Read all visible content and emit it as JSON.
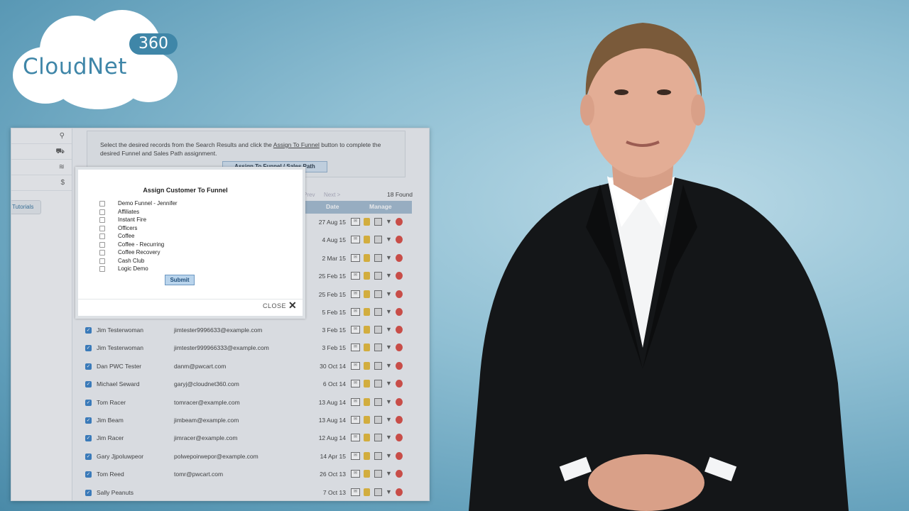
{
  "logo": {
    "brand": "CloudNet",
    "badge": "360"
  },
  "sidebar": {
    "tutorials": "Tutorials"
  },
  "instructions": {
    "text_before": "Select the desired records from the Search Results and click the ",
    "link": "Assign To Funnel",
    "text_after": " button to complete the desired Funnel and Sales Path assignment.",
    "button": "Assign To Funnel / Sales Path"
  },
  "pager": {
    "prev": "Prev",
    "next": "Next >",
    "found": "18 Found"
  },
  "table": {
    "headers": {
      "date": "Date",
      "manage": "Manage"
    },
    "hidden_dates": [
      "27 Aug 15",
      "4 Aug 15",
      "2 Mar 15",
      "25 Feb 15",
      "25 Feb 15",
      "5 Feb 15"
    ],
    "rows": [
      {
        "name": "Jim Testerwoman",
        "email": "jimtester9996633@example.com",
        "date": "3 Feb 15"
      },
      {
        "name": "Jim Testerwoman",
        "email": "jimtester999966333@example.com",
        "date": "3 Feb 15"
      },
      {
        "name": "Dan PWC Tester",
        "email": "danm@pwcart.com",
        "date": "30 Oct 14"
      },
      {
        "name": "Michael Seward",
        "email": "garyj@cloudnet360.com",
        "date": "6 Oct 14"
      },
      {
        "name": "Tom Racer",
        "email": "tomracer@example.com",
        "date": "13 Aug 14"
      },
      {
        "name": "Jim Beam",
        "email": "jimbeam@example.com",
        "date": "13 Aug 14"
      },
      {
        "name": "Jim Racer",
        "email": "jimracer@example.com",
        "date": "12 Aug 14"
      },
      {
        "name": "Gary Jjpoluwpeor",
        "email": "polwepoirwepor@example.com",
        "date": "14 Apr 15"
      },
      {
        "name": "Tom Reed",
        "email": "tomr@pwcart.com",
        "date": "26 Oct 13"
      },
      {
        "name": "Sally Peanuts",
        "email": "",
        "date": "7 Oct 13"
      }
    ]
  },
  "modal": {
    "title": "Assign Customer To Funnel",
    "options": [
      "Demo Funnel - Jennifer",
      "Affiliates",
      "Instant Fire",
      "Officers",
      "Coffee",
      "Coffee - Recurring",
      "Coffee Recovery",
      "Cash Club",
      "Logic Demo"
    ],
    "submit": "Submit",
    "close": "CLOSE"
  },
  "colors": {
    "brand_blue": "#3f86a8",
    "checkbox_blue": "#2d79c4",
    "table_header": "#9eb7cd",
    "delete_red": "#d9423a"
  }
}
